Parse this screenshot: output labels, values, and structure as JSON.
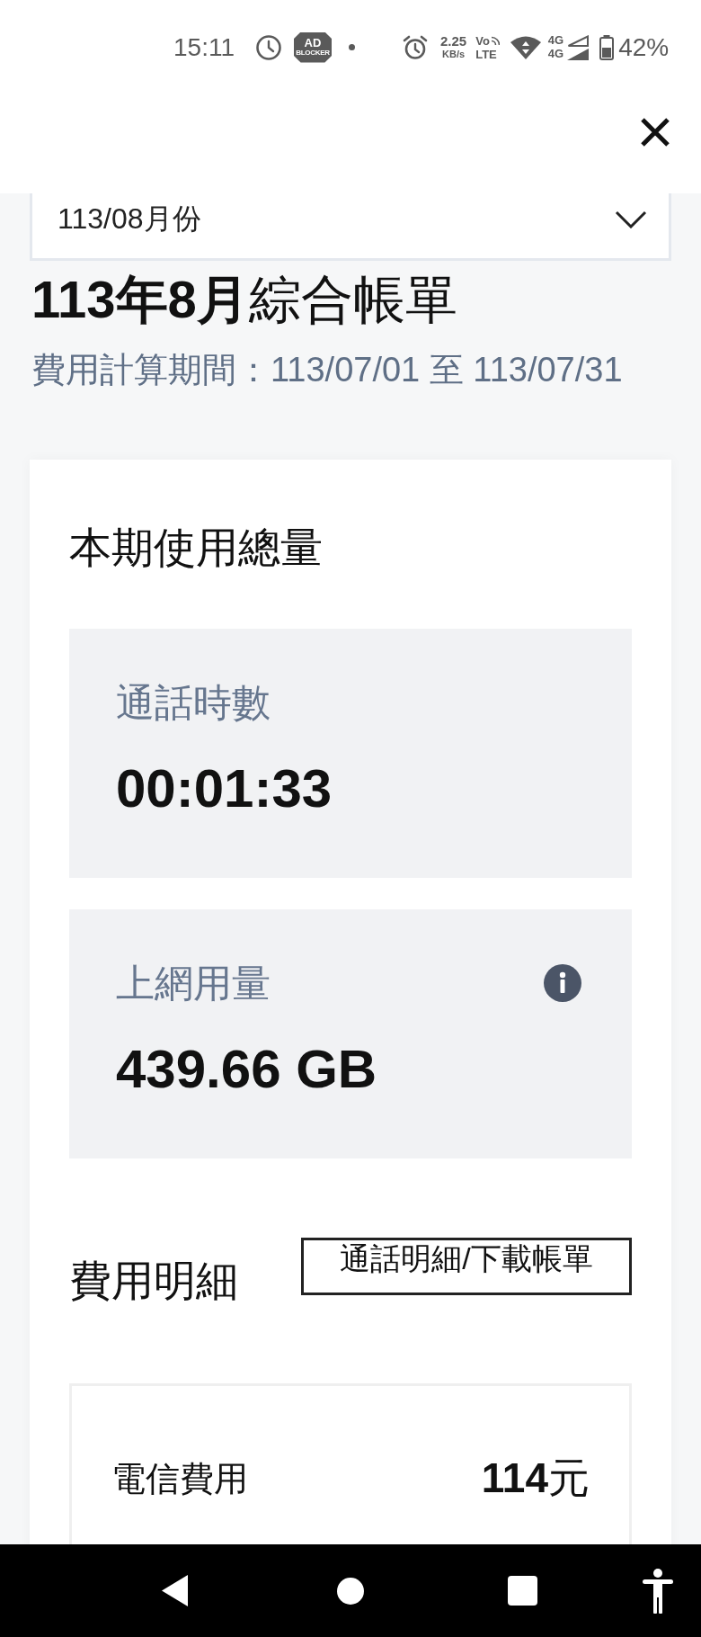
{
  "status_bar": {
    "time": "15:11",
    "ad_badge": {
      "top": "AD",
      "bottom": "BLOCKER"
    },
    "speed": {
      "value": "2.25",
      "unit": "KB/s"
    },
    "volte": {
      "top": "Vo",
      "bottom": "LTE"
    },
    "networks": [
      {
        "type": "4G",
        "kind": "outline"
      },
      {
        "type": "4G",
        "kind": "solid"
      }
    ],
    "battery": "42%"
  },
  "month_select": {
    "value": "113/08月份"
  },
  "title": "**113年8月**綜合帳單",
  "period": "費用計算期間：113/07/01 至 113/07/31",
  "usage": {
    "title": "本期使用總量",
    "items": [
      {
        "label": "通話時數",
        "value": "00:01:33",
        "info": false
      },
      {
        "label": "上網用量",
        "value": "439.66 GB",
        "info": true
      }
    ]
  },
  "fees": {
    "title": "費用明細",
    "action": "通話明細/下載帳單",
    "items": [
      {
        "label": "電信費用",
        "amount": "**114**元"
      }
    ]
  }
}
